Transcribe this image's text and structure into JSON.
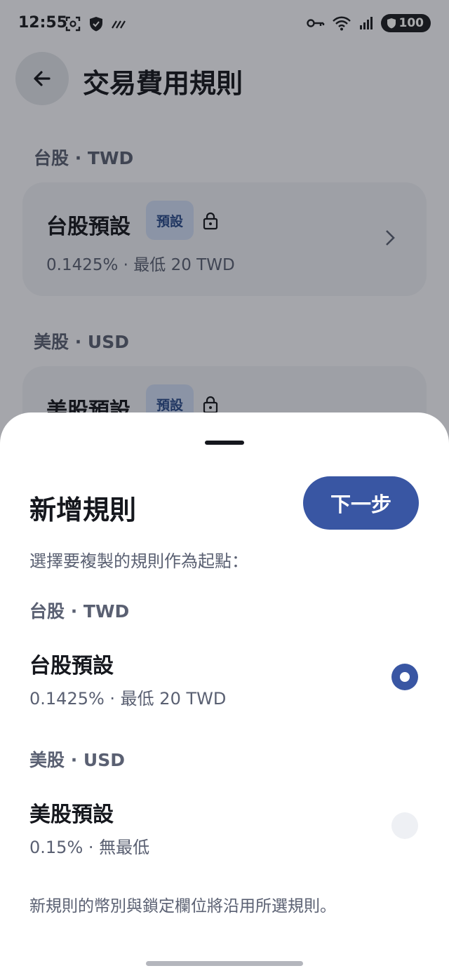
{
  "status_bar": {
    "time": "12:55",
    "battery": "100"
  },
  "app_bar": {
    "title": "交易費用規則"
  },
  "background": {
    "sections": [
      {
        "label": "台股 · TWD",
        "card": {
          "title": "台股預設",
          "badge": "預設",
          "subtitle": "0.1425% · 最低 20 TWD"
        }
      },
      {
        "label": "美股 · USD",
        "card": {
          "title": "美股預設",
          "badge": "預設"
        }
      }
    ]
  },
  "sheet": {
    "title": "新增規則",
    "next_label": "下一步",
    "description": "選擇要複製的規則作為起點：",
    "groups": [
      {
        "label": "台股 · TWD",
        "option": {
          "title": "台股預設",
          "subtitle": "0.1425% · 最低 20 TWD",
          "selected": true
        }
      },
      {
        "label": "美股 · USD",
        "option": {
          "title": "美股預設",
          "subtitle": "0.15% · 無最低",
          "selected": false
        }
      }
    ],
    "note": "新規則的幣別與鎖定欄位將沿用所選規則。"
  },
  "colors": {
    "accent": "#3956a3",
    "badge_bg": "#cfdcf5",
    "text": "#15171d",
    "muted": "#5a6072"
  }
}
